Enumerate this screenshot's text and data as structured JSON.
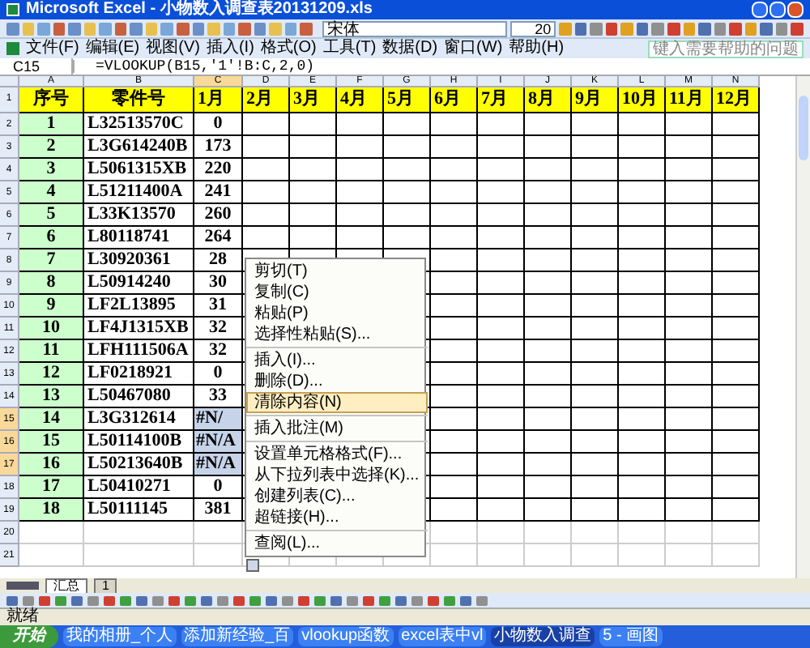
{
  "window": {
    "title": "Microsoft Excel - 小物数入调查表20131209.xls"
  },
  "toolbar": {
    "font": "宋体",
    "size": "20"
  },
  "menu": [
    {
      "label": "文件(F)"
    },
    {
      "label": "编辑(E)"
    },
    {
      "label": "视图(V)"
    },
    {
      "label": "插入(I)"
    },
    {
      "label": "格式(O)"
    },
    {
      "label": "工具(T)"
    },
    {
      "label": "数据(D)"
    },
    {
      "label": "窗口(W)"
    },
    {
      "label": "帮助(H)"
    }
  ],
  "help": {
    "placeholder": "键入需要帮助的问题"
  },
  "formula_bar": {
    "name_box": "C15",
    "formula": "=VLOOKUP(B15,'1'!B:C,2,0)"
  },
  "columns": [
    {
      "label": "A",
      "selected": false
    },
    {
      "label": "B",
      "selected": false
    },
    {
      "label": "C",
      "selected": true
    },
    {
      "label": "D",
      "selected": false
    },
    {
      "label": "E",
      "selected": false
    },
    {
      "label": "F",
      "selected": false
    },
    {
      "label": "G",
      "selected": false
    },
    {
      "label": "H",
      "selected": false
    },
    {
      "label": "I",
      "selected": false
    },
    {
      "label": "J",
      "selected": false
    },
    {
      "label": "K",
      "selected": false
    },
    {
      "label": "L",
      "selected": false
    },
    {
      "label": "M",
      "selected": false
    },
    {
      "label": "N",
      "selected": false
    }
  ],
  "header_row_number": "1",
  "header_row": [
    "序号",
    "零件号",
    "1月",
    "2月",
    "3月",
    "4月",
    "5月",
    "6月",
    "7月",
    "8月",
    "9月",
    "10月",
    "11月",
    "12月"
  ],
  "rows": [
    {
      "row": "2",
      "no": "1",
      "part": "L32513570C",
      "jan": "0",
      "selected": false
    },
    {
      "row": "3",
      "no": "2",
      "part": "L3G614240B",
      "jan": "173",
      "selected": false
    },
    {
      "row": "4",
      "no": "3",
      "part": "L5061315XB",
      "jan": "220",
      "selected": false
    },
    {
      "row": "5",
      "no": "4",
      "part": "L51211400A",
      "jan": "241",
      "selected": false
    },
    {
      "row": "6",
      "no": "5",
      "part": "L33K13570",
      "jan": "260",
      "selected": false
    },
    {
      "row": "7",
      "no": "6",
      "part": "L80118741",
      "jan": "264",
      "selected": false
    },
    {
      "row": "8",
      "no": "7",
      "part": "L30920361",
      "jan": "28",
      "selected": false
    },
    {
      "row": "9",
      "no": "8",
      "part": "L50914240",
      "jan": "30",
      "selected": false
    },
    {
      "row": "10",
      "no": "9",
      "part": "LF2L13895",
      "jan": "31",
      "selected": false
    },
    {
      "row": "11",
      "no": "10",
      "part": "LF4J1315XB",
      "jan": "32",
      "selected": false
    },
    {
      "row": "12",
      "no": "11",
      "part": "LFH111506A",
      "jan": "32",
      "selected": false
    },
    {
      "row": "13",
      "no": "12",
      "part": "LF0218921",
      "jan": "0",
      "selected": false
    },
    {
      "row": "14",
      "no": "13",
      "part": "L50467080",
      "jan": "33",
      "selected": false
    },
    {
      "row": "15",
      "no": "14",
      "part": "L3G312614",
      "jan": "#N/",
      "selected": true
    },
    {
      "row": "16",
      "no": "15",
      "part": "L50114100B",
      "jan": "#N/A",
      "selected": true
    },
    {
      "row": "17",
      "no": "16",
      "part": "L50213640B",
      "jan": "#N/A",
      "selected": true
    },
    {
      "row": "18",
      "no": "17",
      "part": "L50410271",
      "jan": "0",
      "selected": false
    },
    {
      "row": "19",
      "no": "18",
      "part": "L50111145",
      "jan": "381",
      "selected": false
    },
    {
      "row": "20",
      "no": "",
      "part": "",
      "jan": "",
      "selected": false
    },
    {
      "row": "21",
      "no": "",
      "part": "",
      "jan": "",
      "selected": false
    }
  ],
  "context_menu": [
    {
      "label": "剪切(T)",
      "selected": false,
      "separator_before": false
    },
    {
      "label": "复制(C)",
      "selected": false,
      "separator_before": false
    },
    {
      "label": "粘贴(P)",
      "selected": false,
      "separator_before": false
    },
    {
      "label": "选择性粘贴(S)...",
      "selected": false,
      "separator_before": false
    },
    {
      "label": "插入(I)...",
      "selected": false,
      "separator_before": true
    },
    {
      "label": "删除(D)...",
      "selected": false,
      "separator_before": false
    },
    {
      "label": "清除内容(N)",
      "selected": true,
      "separator_before": false
    },
    {
      "label": "插入批注(M)",
      "selected": false,
      "separator_before": true
    },
    {
      "label": "设置单元格格式(F)...",
      "selected": false,
      "separator_before": true
    },
    {
      "label": "从下拉列表中选择(K)...",
      "selected": false,
      "separator_before": false
    },
    {
      "label": "创建列表(C)...",
      "selected": false,
      "separator_before": false
    },
    {
      "label": "超链接(H)...",
      "selected": false,
      "separator_before": false
    },
    {
      "label": "查阅(L)...",
      "selected": false,
      "separator_before": true
    }
  ],
  "sheet_tabs": [
    {
      "label": "汇总",
      "selected": true
    },
    {
      "label": "1",
      "selected": false
    }
  ],
  "status_bar": {
    "text": "就绪"
  },
  "taskbar": {
    "start": "开始",
    "tasks": [
      {
        "label": "我的相册_个人",
        "selected": false
      },
      {
        "label": "添加新经验_百",
        "selected": false
      },
      {
        "label": "vlookup函数",
        "selected": false
      },
      {
        "label": "excel表中vl",
        "selected": false
      },
      {
        "label": "小物数入调查",
        "selected": true
      },
      {
        "label": "5 - 画图",
        "selected": false
      }
    ]
  }
}
